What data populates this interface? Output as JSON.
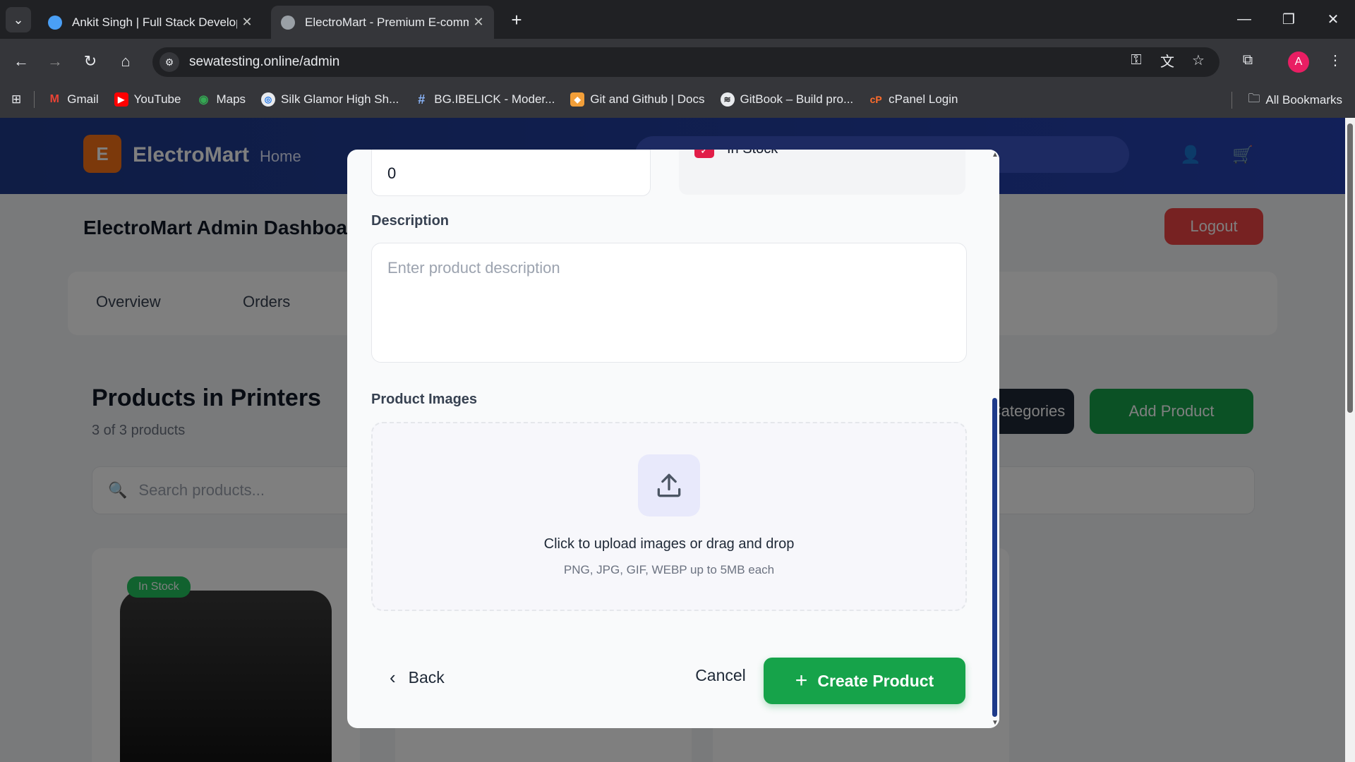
{
  "browser": {
    "tabs": [
      {
        "title": "Ankit Singh | Full Stack Develop",
        "active": false
      },
      {
        "title": "ElectroMart - Premium E-comm",
        "active": true
      }
    ],
    "url": "sewatesting.online/admin",
    "bookmarks": [
      "Gmail",
      "YouTube",
      "Maps",
      "Silk Glamor High Sh...",
      "BG.IBELICK - Moder...",
      "Git and Github | Docs",
      "GitBook – Build pro...",
      "cPanel Login"
    ],
    "all_bookmarks": "All Bookmarks",
    "avatar_letter": "A"
  },
  "background_page": {
    "logo_letter": "E",
    "logo_text": "ElectroMart",
    "nav_home": "Home",
    "dashboard_title": "ElectroMart Admin Dashboard",
    "logout": "Logout",
    "tabs": [
      "Overview",
      "Orders"
    ],
    "products_title": "Products in Printers",
    "products_count": "3 of 3 products",
    "categories_button": "Categories",
    "add_product_button": "Add Product",
    "search_placeholder": "Search products...",
    "badge": "In Stock"
  },
  "modal": {
    "stock_value": "0",
    "in_stock_label": "In Stock",
    "description_label": "Description",
    "description_placeholder": "Enter product description",
    "images_label": "Product Images",
    "upload_main": "Click to upload images or drag and drop",
    "upload_sub": "PNG, JPG, GIF, WEBP up to 5MB each",
    "back": "Back",
    "cancel": "Cancel",
    "create": "Create Product"
  },
  "colors": {
    "primary_green": "#16a34a",
    "header_blue": "#1e3a8a",
    "danger_red": "#ef4444",
    "checkbox_pink": "#e11d48"
  }
}
